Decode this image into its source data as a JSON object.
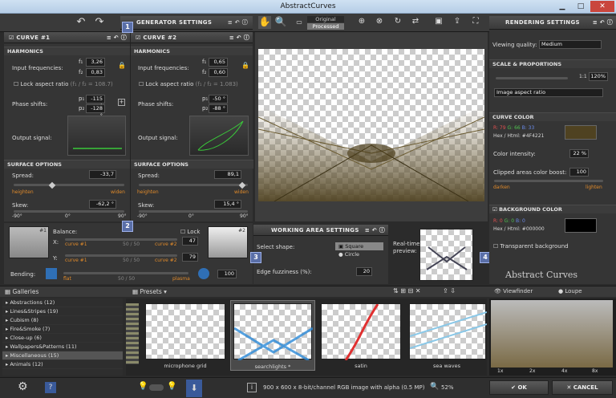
{
  "app": {
    "title": "AbstractCurves"
  },
  "toolbar": {
    "original": "Original",
    "processed": "Processed"
  },
  "generator": {
    "title": "GENERATOR SETTINGS",
    "curve1": {
      "title": "CURVE #1",
      "f1": "3,26",
      "f2": "0,83",
      "ratio": "(f₁ / f₂ = 108.7)",
      "p1": "-115 °",
      "p2": "-128 °",
      "spread": "-33,7",
      "skew": "-62,2 °"
    },
    "curve2": {
      "title": "CURVE #2",
      "f1": "0,65",
      "f2": "0,60",
      "ratio": "(f₁ / f₂ = 1.083)",
      "p1": "-50 °",
      "p2": "-88 °",
      "spread": "89,1",
      "skew": "15,4 °"
    },
    "labels": {
      "harmonics": "HARMONICS",
      "input_freq": "Input frequencies:",
      "lock_aspect": "Lock aspect ratio",
      "phase": "Phase shifts:",
      "output": "Output signal:",
      "surface": "SURFACE OPTIONS",
      "spread": "Spread:",
      "skew": "Skew:",
      "heighten": "heighten",
      "widen": "widen",
      "f1": "f₁",
      "f2": "f₂",
      "p1": "p₁",
      "p2": "p₂"
    },
    "skew_ticks": [
      "-90°",
      "0°",
      "90°"
    ],
    "skew_ticks2": [
      "-90°",
      "0°",
      "90°"
    ],
    "balance": {
      "label": "Balance:",
      "x": "X:",
      "y": "Y:",
      "lock": "Lock",
      "curve1": "curve #1",
      "curve2": "curve #2",
      "mid": "50 / 50",
      "xval": "47",
      "yval": "79",
      "n1": "#1",
      "n2": "#2"
    },
    "bending": {
      "label": "Bending:",
      "flat": "flat",
      "mid": "50 / 50",
      "plasma": "plasma",
      "val": "100"
    }
  },
  "working": {
    "title": "WORKING AREA SETTINGS",
    "select_shape": "Select shape:",
    "square": "Square",
    "circle": "Circle",
    "edge": "Edge fuzziness (%):",
    "edge_val": "20",
    "preview": "Real-time\npreview:"
  },
  "badges": [
    "1",
    "2",
    "3",
    "4"
  ],
  "rendering": {
    "title": "RENDERING SETTINGS",
    "viewing_quality": "Viewing quality:",
    "quality_val": "Medium",
    "scale_title": "SCALE & PROPORTIONS",
    "ratio": "1:1",
    "zoom": "120%",
    "aspect": "Image aspect ratio",
    "curve_color": "CURVE COLOR",
    "r": "R: 79",
    "g": "G: 66",
    "b": "B: 33",
    "hex": "Hex / Html: #4F4221",
    "curve_hex": "#4F4221",
    "intensity": "Color intensity:",
    "intensity_val": "22 %",
    "clipped": "Clipped areas color boost:",
    "clipped_val": "100",
    "darken": "darken",
    "lighten": "lighten",
    "bg_color": "BACKGROUND COLOR",
    "br": "R: 0",
    "bg": "G: 0",
    "bb": "B: 0",
    "bhex": "Hex / Html: #000000",
    "transparent": "Transparent background",
    "logo": "Abstract Curves"
  },
  "galleries": {
    "title": "Galleries",
    "items": [
      "Abstractions (12)",
      "Lines&Stripes (19)",
      "Cubism (8)",
      "Fire&Smoke (7)",
      "Close-up (6)",
      "Wallpapers&Patterns (11)",
      "Miscellaneous (15)",
      "Animals (12)"
    ]
  },
  "presets": {
    "title": "Presets",
    "items": [
      {
        "name": "microphone grid"
      },
      {
        "name": "searchlights *"
      },
      {
        "name": "satin"
      },
      {
        "name": "sea waves"
      }
    ]
  },
  "viewfinder": {
    "viewfinder": "Viewfinder",
    "loupe": "Loupe",
    "zooms": [
      "1x",
      "2x",
      "4x",
      "8x"
    ]
  },
  "status": {
    "info": "900 x 600 x 8-bit/channel RGB image with alpha  (0.5 MP)",
    "zoom": "52%",
    "ok": "OK",
    "cancel": "CANCEL"
  },
  "colors": {
    "accent": "#5a6fa8",
    "curve": "#4F4221"
  }
}
